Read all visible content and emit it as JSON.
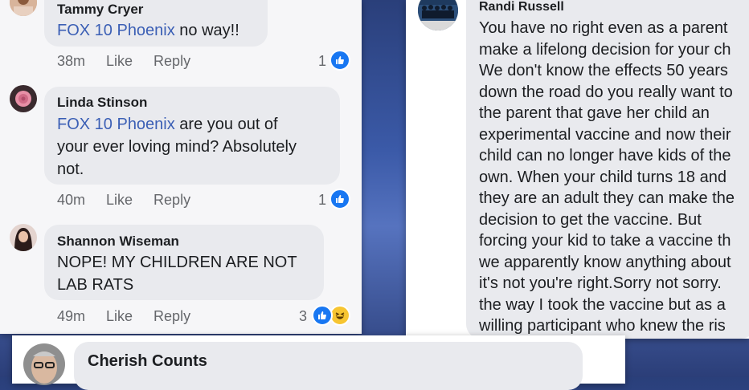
{
  "comments": [
    {
      "author": "Tammy Cryer",
      "tag": "FOX 10 Phoenix",
      "text": " no way!!",
      "time": "38m",
      "like": "Like",
      "reply": "Reply",
      "reactions": "1"
    },
    {
      "author": "Linda Stinson",
      "tag": "FOX 10 Phoenix",
      "text_line1": " are you out of",
      "text_line2": "your ever loving mind? Absolutely",
      "text_line3": "not.",
      "time": "40m",
      "like": "Like",
      "reply": "Reply",
      "reactions": "1"
    },
    {
      "author": "Shannon Wiseman",
      "text_line1": "NOPE! MY CHILDREN ARE NOT",
      "text_line2": "LAB RATS",
      "time": "49m",
      "like": "Like",
      "reply": "Reply",
      "reactions": "3"
    }
  ],
  "randi": {
    "author": "Randi Russell",
    "lines": [
      "You have no right even as a parent",
      "make a lifelong decision for your ch",
      "We don't know the effects 50 years",
      "down the road do you really want to",
      "the parent that gave her child an",
      "experimental vaccine and now their",
      "child can no longer have kids of the",
      "own. When your child turns 18 and",
      "they are an adult they can make the",
      "decision to get the vaccine. But",
      "forcing your kid to take a vaccine th",
      "we apparently know anything about",
      "it's not you're right.Sorry not sorry.",
      "the way I took the vaccine but as a",
      "willing participant who knew the ris"
    ]
  },
  "cherish": {
    "author": "Cherish Counts"
  },
  "colors": {
    "tag": "#3b5fb5",
    "like_reaction": "#1877f2",
    "haha_reaction": "#f7c531"
  },
  "icons": [
    "thumbs-up-icon",
    "haha-icon"
  ]
}
